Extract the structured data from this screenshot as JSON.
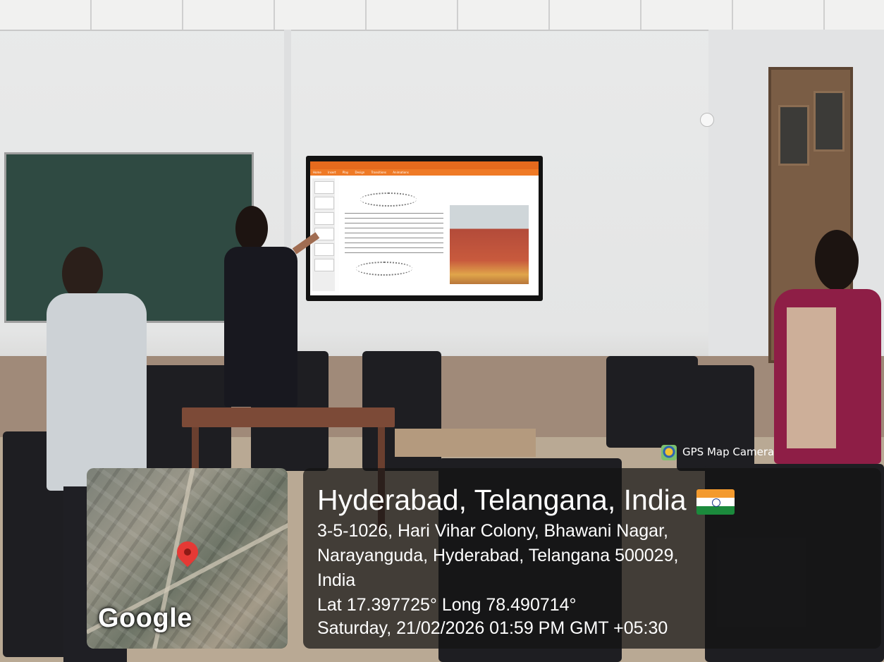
{
  "photo": {
    "description_tags": []
  },
  "presentation": {
    "tab_title": "",
    "menu": [
      "Home",
      "Insert",
      "Play",
      "Design",
      "Transitions",
      "Animations"
    ]
  },
  "overlay": {
    "app_badge": "GPS Map Camera",
    "map_brand": "Google",
    "place_title": "Hyderabad, Telangana, India",
    "address_line_1": "3-5-1026, Hari Vihar Colony, Bhawani Nagar,",
    "address_line_2": "Narayanguda, Hyderabad, Telangana 500029,",
    "address_line_3": "India",
    "coordinates": "Lat 17.397725° Long 78.490714°",
    "timestamp": "Saturday, 21/02/2026 01:59 PM GMT +05:30",
    "flag_icon": "india-flag-icon",
    "pin_icon": "map-pin-icon",
    "accent_colors": {
      "pin": "#e53935",
      "panel": "#141414"
    }
  }
}
